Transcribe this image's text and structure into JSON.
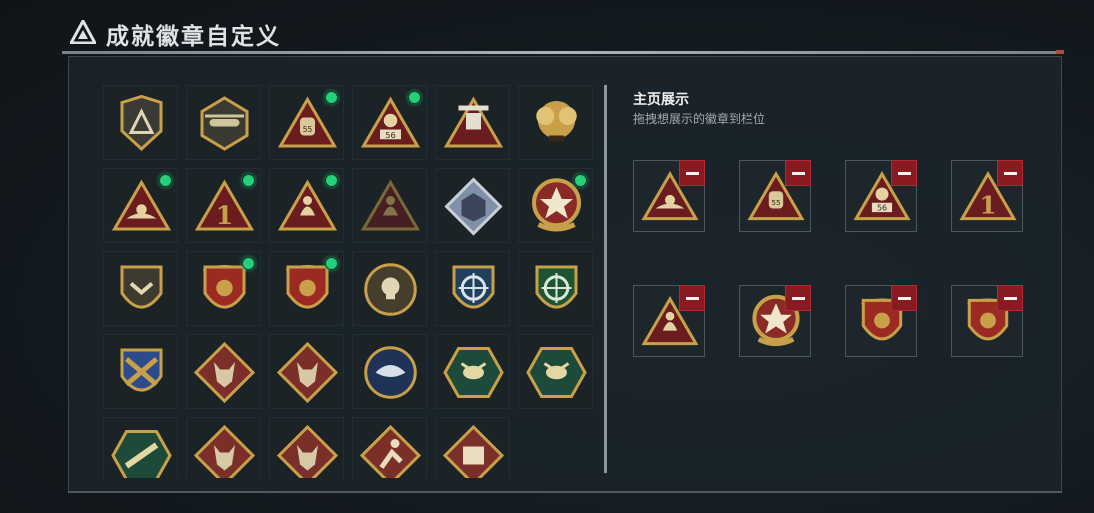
{
  "header": {
    "title": "成就徽章自定义",
    "logo_icon": "triangle-logo-icon"
  },
  "showcase": {
    "title": "主页展示",
    "subtitle": "拖拽想展示的徽章到栏位",
    "remove_icon": "minus-icon",
    "slots": [
      {
        "badge": "nest-triangle-badge-icon"
      },
      {
        "badge": "sack-55-triangle-badge-icon"
      },
      {
        "badge": "fist-56-triangle-badge-icon"
      },
      {
        "badge": "rank-1-triangle-badge-icon"
      },
      {
        "badge": "soldiers-triangle-badge-icon"
      },
      {
        "badge": "star-medallion-badge-icon"
      },
      {
        "badge": "banner-shield-badge-icon"
      },
      {
        "badge": "banner-shield-hex-badge-icon"
      }
    ]
  },
  "badges": [
    {
      "badge": "triangle-shield-badge-icon",
      "new": false
    },
    {
      "badge": "helicopter-badge-icon",
      "new": false
    },
    {
      "badge": "sack-55-triangle-badge-icon",
      "new": true
    },
    {
      "badge": "fist-56-triangle-badge-icon",
      "new": true
    },
    {
      "badge": "mech-triangle-badge-icon",
      "new": false
    },
    {
      "badge": "gold-cluster-badge-icon",
      "new": false
    },
    {
      "badge": "nest-triangle-badge-icon",
      "new": true
    },
    {
      "badge": "rank-1-triangle-badge-icon",
      "new": true
    },
    {
      "badge": "soldiers-triangle-badge-icon",
      "new": true
    },
    {
      "badge": "soldiers-locked-badge-icon",
      "new": false
    },
    {
      "badge": "cube-diamond-badge-icon",
      "new": false
    },
    {
      "badge": "star-medallion-badge-icon",
      "new": true
    },
    {
      "badge": "chevron-shield-badge-icon",
      "new": false
    },
    {
      "badge": "banner-shield-badge-icon",
      "new": true
    },
    {
      "badge": "banner-shield-hex-badge-icon",
      "new": true
    },
    {
      "badge": "skull-round-badge-icon",
      "new": false
    },
    {
      "badge": "crosshair-blue-shield-badge-icon",
      "new": false
    },
    {
      "badge": "crosshair-green-shield-badge-icon",
      "new": false
    },
    {
      "badge": "crossed-tools-shield-badge-icon",
      "new": false
    },
    {
      "badge": "wolf-diamond-badge-icon",
      "new": false
    },
    {
      "badge": "wolf-diamond-alt-badge-icon",
      "new": false
    },
    {
      "badge": "eagle-round-badge-icon",
      "new": false
    },
    {
      "badge": "hornet-hex-badge-icon",
      "new": false
    },
    {
      "badge": "hornet-hex-alt-badge-icon",
      "new": false
    },
    {
      "badge": "rifle-hex-badge-icon",
      "new": false
    },
    {
      "badge": "dragon-diamond-badge-icon",
      "new": false
    },
    {
      "badge": "dragon-diamond-alt-badge-icon",
      "new": false
    },
    {
      "badge": "runner-diamond-badge-icon",
      "new": false
    },
    {
      "badge": "crate-diamond-badge-icon",
      "new": false
    }
  ],
  "colors": {
    "badge_gold": "#c9a04a",
    "badge_dark_red": "#6a1c1f",
    "new_dot": "#25d07a",
    "remove_red": "#8a1a22"
  }
}
